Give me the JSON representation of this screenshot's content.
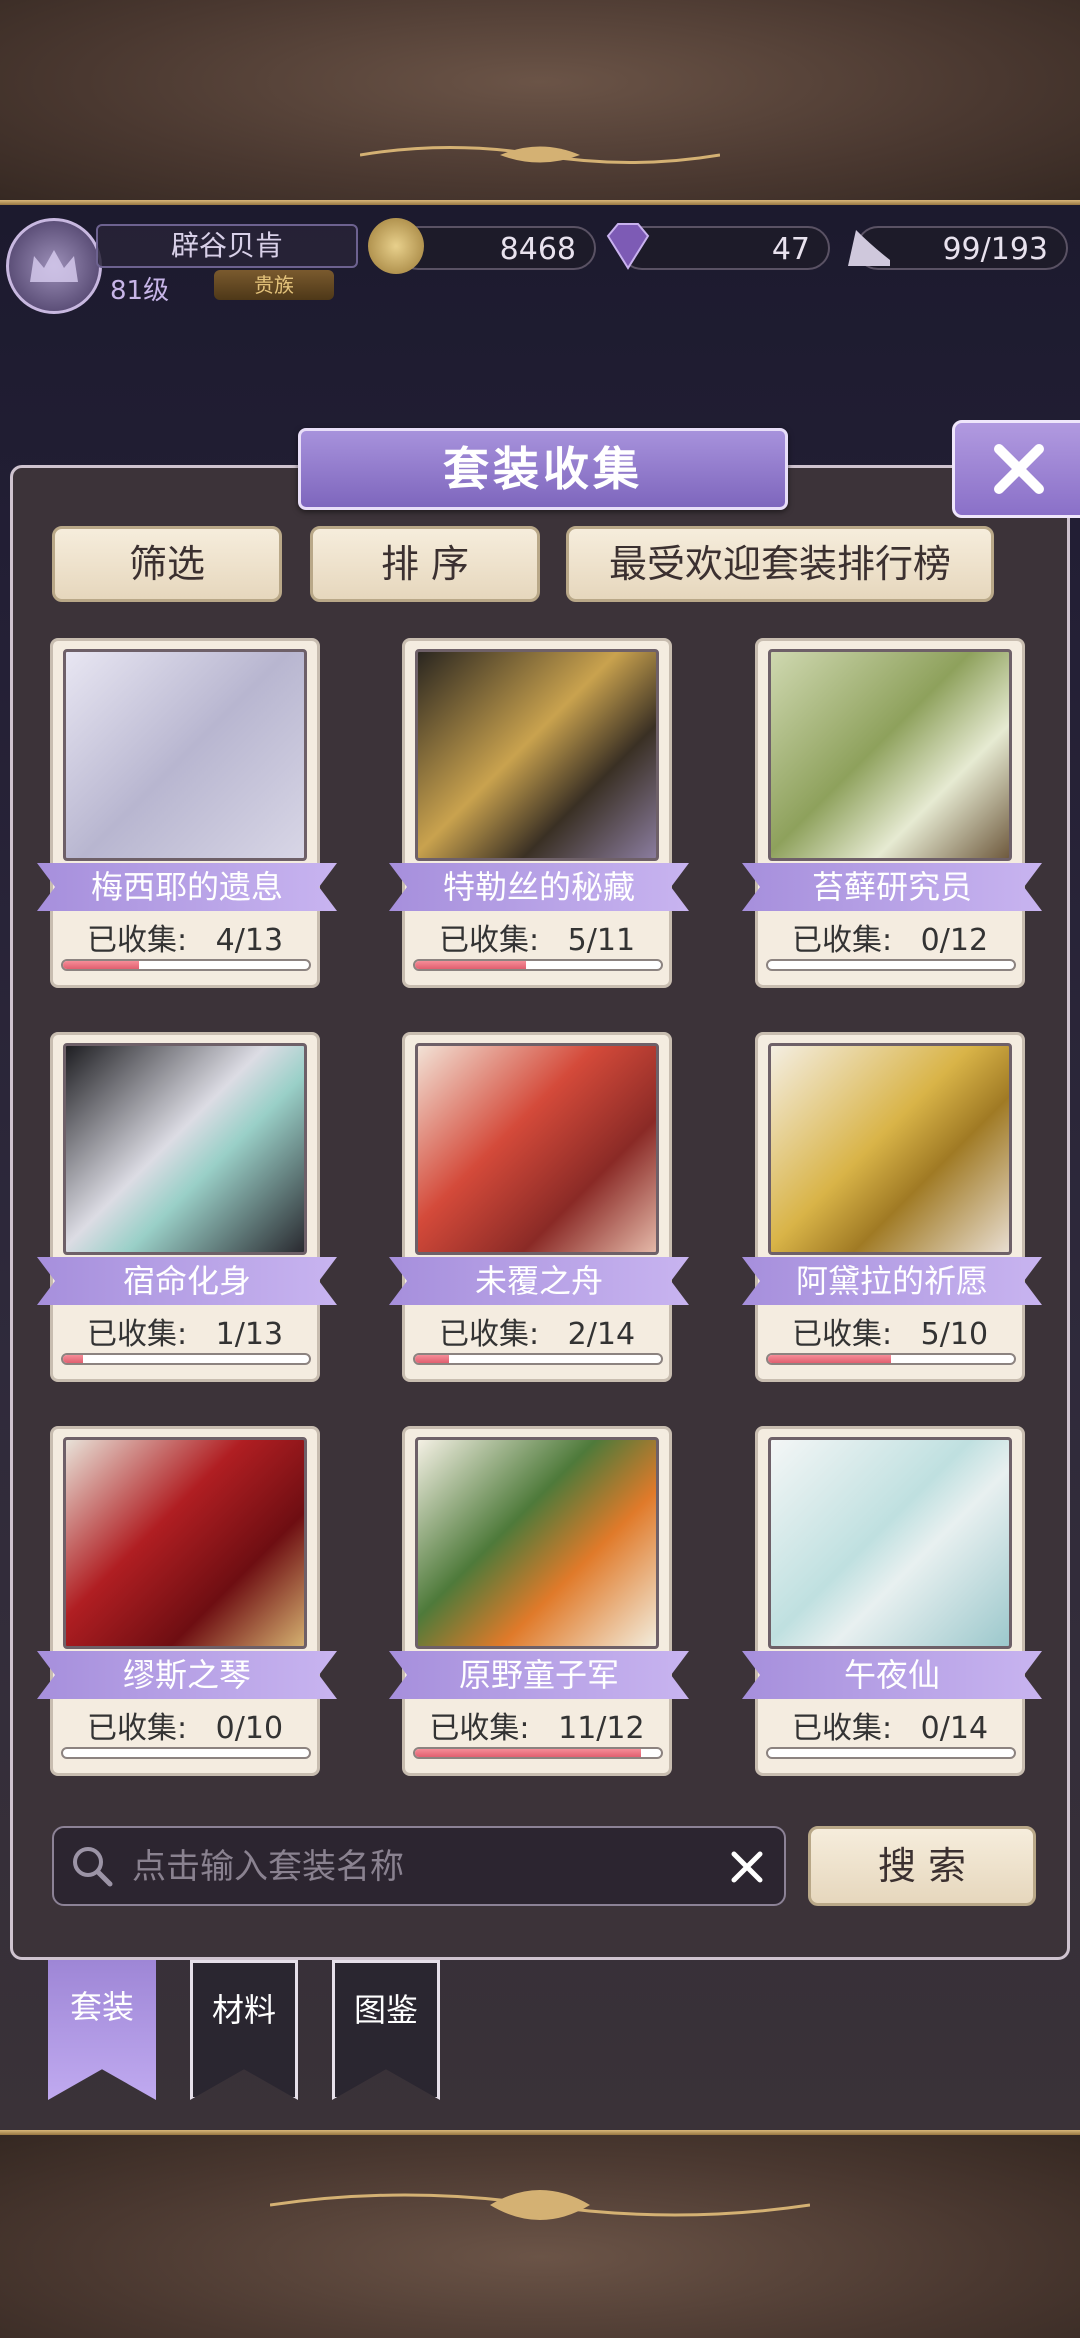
{
  "header": {
    "player_name": "辟谷贝肯",
    "level": "81级",
    "rank_badge": "贵族",
    "gold": "8468",
    "diamond": "47",
    "stamina": "99/193",
    "gold_icon": "crown-coin-icon",
    "diamond_icon": "diamond-icon",
    "stamina_icon": "high-heel-icon"
  },
  "panel": {
    "title": "套装收集",
    "close_icon": "close-x-icon",
    "buttons": {
      "filter": "筛选",
      "sort": "排 序",
      "ranking": "最受欢迎套装排行榜"
    }
  },
  "suits": [
    {
      "name": "梅西耶的遗息",
      "collected_label": "已收集:",
      "collected": "4/13",
      "progress": 0.31
    },
    {
      "name": "特勒丝的秘藏",
      "collected_label": "已收集:",
      "collected": "5/11",
      "progress": 0.45
    },
    {
      "name": "苔藓研究员",
      "collected_label": "已收集:",
      "collected": "0/12",
      "progress": 0.0
    },
    {
      "name": "宿命化身",
      "collected_label": "已收集:",
      "collected": "1/13",
      "progress": 0.08
    },
    {
      "name": "未覆之舟",
      "collected_label": "已收集:",
      "collected": "2/14",
      "progress": 0.14
    },
    {
      "name": "阿黛拉的祈愿",
      "collected_label": "已收集:",
      "collected": "5/10",
      "progress": 0.5
    },
    {
      "name": "缪斯之琴",
      "collected_label": "已收集:",
      "collected": "0/10",
      "progress": 0.0
    },
    {
      "name": "原野童子军",
      "collected_label": "已收集:",
      "collected": "11/12",
      "progress": 0.92
    },
    {
      "name": "午夜仙",
      "collected_label": "已收集:",
      "collected": "0/14",
      "progress": 0.0
    }
  ],
  "search": {
    "placeholder": "点击输入套装名称",
    "value": "",
    "button": "搜 索"
  },
  "tabs": [
    {
      "label": "套装",
      "active": true
    },
    {
      "label": "材料",
      "active": false
    },
    {
      "label": "图鉴",
      "active": false
    }
  ],
  "colors": {
    "accent": "#9e86d6",
    "progress": "#e05f70",
    "panel": "#3c3339"
  }
}
